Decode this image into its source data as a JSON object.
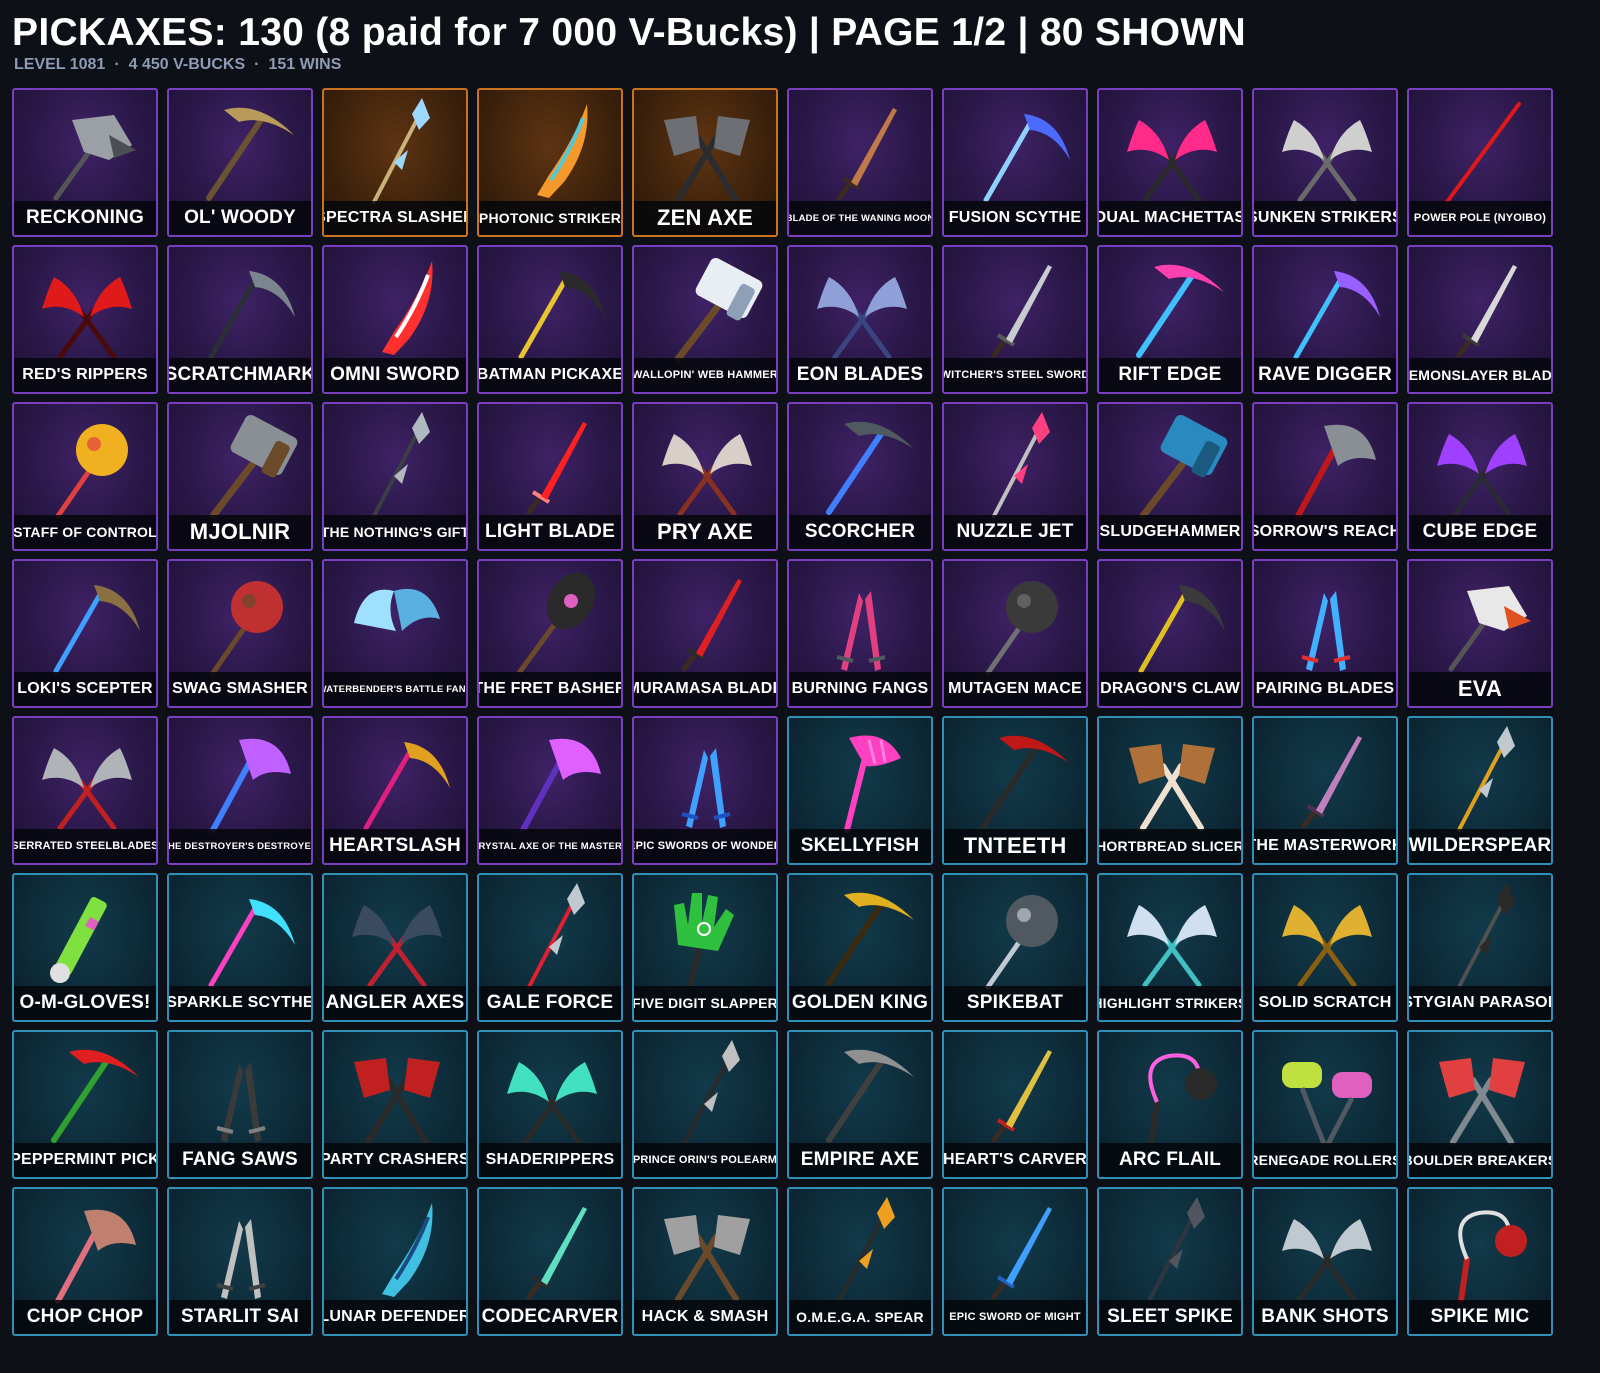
{
  "header": {
    "title": "PICKAXES: 130 (8 paid for 7 000 V-Bucks) | PAGE 1/2 | 80 SHOWN",
    "level": "LEVEL 1081",
    "vbucks": "4 450 V-BUCKS",
    "wins": "151 WINS",
    "separator": "·"
  },
  "colors": {
    "epic": "#7a3fc0",
    "legendary": "#c9731e",
    "rare": "#2f8fb6",
    "background": "#0d1016"
  },
  "items": [
    {
      "name": "RECKONING",
      "rarity": "epic",
      "icon": "claw-pick",
      "c1": "#9aa0a6",
      "c2": "#4b4f55"
    },
    {
      "name": "OL' WOODY",
      "rarity": "epic",
      "icon": "pick",
      "c1": "#b89a5a",
      "c2": "#6b5230"
    },
    {
      "name": "SPECTRA SLASHER",
      "rarity": "legendary",
      "icon": "spear",
      "c1": "#9fd8ff",
      "c2": "#c9b37a"
    },
    {
      "name": "PHOTONIC STRIKER",
      "rarity": "legendary",
      "icon": "blade",
      "c1": "#f59a2a",
      "c2": "#54c8d8"
    },
    {
      "name": "ZEN AXE",
      "rarity": "legendary",
      "icon": "dual-axe",
      "c1": "#6d6f75",
      "c2": "#2b2c30"
    },
    {
      "name": "BLADE OF THE WANING MOON",
      "rarity": "epic",
      "icon": "sword",
      "c1": "#c07a4a",
      "c2": "#3a2a20"
    },
    {
      "name": "FUSION SCYTHE",
      "rarity": "epic",
      "icon": "scythe",
      "c1": "#4b6bff",
      "c2": "#8fd0ff"
    },
    {
      "name": "DUAL MACHETTAS",
      "rarity": "epic",
      "icon": "dual-claw",
      "c1": "#ff2a8a",
      "c2": "#2a2a2a"
    },
    {
      "name": "SUNKEN STRIKERS",
      "rarity": "epic",
      "icon": "dual-claw",
      "c1": "#cfcfcf",
      "c2": "#6a6a6a"
    },
    {
      "name": "POWER POLE (NYOIBO)",
      "rarity": "epic",
      "icon": "staff",
      "c1": "#e01818",
      "c2": "#e01818"
    },
    {
      "name": "RED'S RIPPERS",
      "rarity": "epic",
      "icon": "dual-claw",
      "c1": "#e01a1a",
      "c2": "#4a0a0a"
    },
    {
      "name": "SCRATCHMARK",
      "rarity": "epic",
      "icon": "scythe",
      "c1": "#7a8590",
      "c2": "#2a2f35"
    },
    {
      "name": "OMNI SWORD",
      "rarity": "epic",
      "icon": "blade",
      "c1": "#ff3030",
      "c2": "#ffffff"
    },
    {
      "name": "BATMAN PICKAXE",
      "rarity": "epic",
      "icon": "scythe",
      "c1": "#2a2a2a",
      "c2": "#e8c530"
    },
    {
      "name": "WALLOPIN' WEB HAMMER",
      "rarity": "epic",
      "icon": "hammer",
      "c1": "#e9eef5",
      "c2": "#8ea0b8"
    },
    {
      "name": "EON BLADES",
      "rarity": "epic",
      "icon": "dual-claw",
      "c1": "#8fa0d8",
      "c2": "#3a4480"
    },
    {
      "name": "WITCHER'S STEEL SWORD",
      "rarity": "epic",
      "icon": "sword",
      "c1": "#c8ccd0",
      "c2": "#555a60"
    },
    {
      "name": "RIFT EDGE",
      "rarity": "epic",
      "icon": "pick",
      "c1": "#ff40b0",
      "c2": "#40c0ff"
    },
    {
      "name": "RAVE DIGGER",
      "rarity": "epic",
      "icon": "scythe",
      "c1": "#9a60ff",
      "c2": "#40c0ff"
    },
    {
      "name": "DEMONSLAYER BLADE",
      "rarity": "epic",
      "icon": "sword",
      "c1": "#d8d8d8",
      "c2": "#3a3a3a"
    },
    {
      "name": "STAFF OF CONTROL",
      "rarity": "epic",
      "icon": "mace",
      "c1": "#f0b020",
      "c2": "#e04040"
    },
    {
      "name": "MJOLNIR",
      "rarity": "epic",
      "icon": "hammer",
      "c1": "#8a8f96",
      "c2": "#6b4a2a"
    },
    {
      "name": "THE NOTHING'S GIFT",
      "rarity": "epic",
      "icon": "spear",
      "c1": "#b0b8c0",
      "c2": "#3a3f45"
    },
    {
      "name": "LIGHT BLADE",
      "rarity": "epic",
      "icon": "sword",
      "c1": "#ff2020",
      "c2": "#ff8080"
    },
    {
      "name": "PRY AXE",
      "rarity": "epic",
      "icon": "dual-claw",
      "c1": "#d8d0c8",
      "c2": "#8a3020"
    },
    {
      "name": "SCORCHER",
      "rarity": "epic",
      "icon": "pick",
      "c1": "#505860",
      "c2": "#4080ff"
    },
    {
      "name": "NUZZLE JET",
      "rarity": "epic",
      "icon": "spear",
      "c1": "#ff4080",
      "c2": "#c0c0c0"
    },
    {
      "name": "SLUDGEHAMMER",
      "rarity": "epic",
      "icon": "hammer",
      "c1": "#2a8ac0",
      "c2": "#1a5a80"
    },
    {
      "name": "SORROW'S REACH",
      "rarity": "epic",
      "icon": "axe",
      "c1": "#8a8f96",
      "c2": "#c01818"
    },
    {
      "name": "CUBE EDGE",
      "rarity": "epic",
      "icon": "dual-claw",
      "c1": "#a040ff",
      "c2": "#2a2a35"
    },
    {
      "name": "LOKI'S SCEPTER",
      "rarity": "epic",
      "icon": "scythe",
      "c1": "#8a7040",
      "c2": "#40a0ff"
    },
    {
      "name": "SWAG SMASHER",
      "rarity": "epic",
      "icon": "mace",
      "c1": "#c03030",
      "c2": "#6a4a2a"
    },
    {
      "name": "WATERBENDER'S BATTLE FANS",
      "rarity": "epic",
      "icon": "fans",
      "c1": "#9fe0ff",
      "c2": "#5ab0e0"
    },
    {
      "name": "THE FRET BASHER",
      "rarity": "epic",
      "icon": "guitar",
      "c1": "#2a2a2a",
      "c2": "#e060c0"
    },
    {
      "name": "MURAMASA BLADE",
      "rarity": "epic",
      "icon": "sword",
      "c1": "#e02020",
      "c2": "#2a2a2a"
    },
    {
      "name": "BURNING FANGS",
      "rarity": "epic",
      "icon": "dual-sword",
      "c1": "#e04080",
      "c2": "#505860"
    },
    {
      "name": "MUTAGEN MACE",
      "rarity": "epic",
      "icon": "mace",
      "c1": "#3a3a3a",
      "c2": "#707070"
    },
    {
      "name": "DRAGON'S CLAW",
      "rarity": "epic",
      "icon": "scythe",
      "c1": "#3a3a3a",
      "c2": "#e0c020"
    },
    {
      "name": "PAIRING BLADES",
      "rarity": "epic",
      "icon": "dual-sword",
      "c1": "#40b0ff",
      "c2": "#e03030"
    },
    {
      "name": "EVA",
      "rarity": "epic",
      "icon": "claw-pick",
      "c1": "#e8e8e8",
      "c2": "#e05020"
    },
    {
      "name": "SERRATED STEELBLADES",
      "rarity": "epic",
      "icon": "dual-claw",
      "c1": "#b0b4b8",
      "c2": "#c02020"
    },
    {
      "name": "THE DESTROYER'S DESTROYER",
      "rarity": "epic",
      "icon": "axe",
      "c1": "#c060ff",
      "c2": "#4080ff"
    },
    {
      "name": "HEARTSLASH",
      "rarity": "epic",
      "icon": "scythe",
      "c1": "#e0a020",
      "c2": "#e02080"
    },
    {
      "name": "CRYSTAL AXE OF THE MASTERS",
      "rarity": "epic",
      "icon": "axe",
      "c1": "#e060ff",
      "c2": "#6030c0"
    },
    {
      "name": "EPIC SWORDS OF WONDER",
      "rarity": "epic",
      "icon": "dual-sword",
      "c1": "#40a0ff",
      "c2": "#2050c0"
    },
    {
      "name": "SKELLYFISH",
      "rarity": "rare",
      "icon": "fishbone",
      "c1": "#ff40c0",
      "c2": "#ff80e0"
    },
    {
      "name": "TNTEETH",
      "rarity": "rare",
      "icon": "pick",
      "c1": "#c01818",
      "c2": "#2a2a2a"
    },
    {
      "name": "SHORTBREAD SLICERS",
      "rarity": "rare",
      "icon": "dual-axe",
      "c1": "#b0703a",
      "c2": "#f0e0d0"
    },
    {
      "name": "THE MASTERWORK",
      "rarity": "rare",
      "icon": "sword",
      "c1": "#c080c0",
      "c2": "#503050"
    },
    {
      "name": "WILDERSPEAR",
      "rarity": "rare",
      "icon": "spear",
      "c1": "#c0c8d0",
      "c2": "#e0a020"
    },
    {
      "name": "O-M-GLOVES!",
      "rarity": "rare",
      "icon": "stick",
      "c1": "#80e040",
      "c2": "#e060c0"
    },
    {
      "name": "SPARKLE SCYTHE",
      "rarity": "rare",
      "icon": "scythe",
      "c1": "#40e0ff",
      "c2": "#ff40c0"
    },
    {
      "name": "ANGLER AXES",
      "rarity": "rare",
      "icon": "dual-claw",
      "c1": "#3a4a60",
      "c2": "#c02030"
    },
    {
      "name": "GALE FORCE",
      "rarity": "rare",
      "icon": "spear",
      "c1": "#c0c8d0",
      "c2": "#e02030"
    },
    {
      "name": "FIVE DIGIT SLAPPER",
      "rarity": "rare",
      "icon": "hand",
      "c1": "#30c040",
      "c2": "#ffffff"
    },
    {
      "name": "GOLDEN KING",
      "rarity": "rare",
      "icon": "pick",
      "c1": "#e0b020",
      "c2": "#3a2a10"
    },
    {
      "name": "SPIKEBAT",
      "rarity": "rare",
      "icon": "mace",
      "c1": "#505860",
      "c2": "#c0c8d0"
    },
    {
      "name": "HIGHLIGHT STRIKERS",
      "rarity": "rare",
      "icon": "dual-claw",
      "c1": "#d0e0f0",
      "c2": "#40c0c0"
    },
    {
      "name": "SOLID SCRATCH",
      "rarity": "rare",
      "icon": "dual-claw",
      "c1": "#e0b030",
      "c2": "#8a6010"
    },
    {
      "name": "STYGIAN PARASOL",
      "rarity": "rare",
      "icon": "spear",
      "c1": "#2a2a2a",
      "c2": "#505050"
    },
    {
      "name": "PEPPERMINT PICK",
      "rarity": "rare",
      "icon": "pick",
      "c1": "#e02020",
      "c2": "#30a030"
    },
    {
      "name": "FANG SAWS",
      "rarity": "rare",
      "icon": "dual-sword",
      "c1": "#3a3a3a",
      "c2": "#808080"
    },
    {
      "name": "PARTY CRASHERS",
      "rarity": "rare",
      "icon": "dual-axe",
      "c1": "#c02020",
      "c2": "#2a2a2a"
    },
    {
      "name": "SHADERIPPERS",
      "rarity": "rare",
      "icon": "dual-claw",
      "c1": "#40e0c0",
      "c2": "#2a2a2a"
    },
    {
      "name": "PRINCE ORIN'S POLEARM",
      "rarity": "rare",
      "icon": "spear",
      "c1": "#c0c0c0",
      "c2": "#2a2a2a"
    },
    {
      "name": "EMPIRE AXE",
      "rarity": "rare",
      "icon": "pick",
      "c1": "#909090",
      "c2": "#404040"
    },
    {
      "name": "HEART'S CARVER",
      "rarity": "rare",
      "icon": "sword",
      "c1": "#e0c040",
      "c2": "#c02020"
    },
    {
      "name": "ARC FLAIL",
      "rarity": "rare",
      "icon": "flail",
      "c1": "#ff60e0",
      "c2": "#2a2a2a"
    },
    {
      "name": "RENEGADE ROLLERS",
      "rarity": "rare",
      "icon": "rollers",
      "c1": "#c0e040",
      "c2": "#e060c0"
    },
    {
      "name": "BOULDER BREAKERS",
      "rarity": "rare",
      "icon": "dual-axe",
      "c1": "#e04040",
      "c2": "#808890"
    },
    {
      "name": "CHOP CHOP",
      "rarity": "rare",
      "icon": "axe",
      "c1": "#c08070",
      "c2": "#e07080"
    },
    {
      "name": "STARLIT SAI",
      "rarity": "rare",
      "icon": "dual-sword",
      "c1": "#c0c0c0",
      "c2": "#404040"
    },
    {
      "name": "LUNAR DEFENDER",
      "rarity": "rare",
      "icon": "blade",
      "c1": "#40c0e0",
      "c2": "#1a4a80"
    },
    {
      "name": "CODECARVER",
      "rarity": "rare",
      "icon": "sword",
      "c1": "#60e0c0",
      "c2": "#2a2a2a"
    },
    {
      "name": "HACK & SMASH",
      "rarity": "rare",
      "icon": "dual-axe",
      "c1": "#a0a0a0",
      "c2": "#6a4a2a"
    },
    {
      "name": "O.M.E.G.A. SPEAR",
      "rarity": "rare",
      "icon": "spear",
      "c1": "#f0a020",
      "c2": "#2a2a2a"
    },
    {
      "name": "EPIC SWORD OF MIGHT",
      "rarity": "rare",
      "icon": "sword",
      "c1": "#40a0ff",
      "c2": "#2060c0"
    },
    {
      "name": "SLEET SPIKE",
      "rarity": "rare",
      "icon": "spear",
      "c1": "#505560",
      "c2": "#303540"
    },
    {
      "name": "BANK SHOTS",
      "rarity": "rare",
      "icon": "dual-claw",
      "c1": "#c0c8d0",
      "c2": "#2a2a2a"
    },
    {
      "name": "SPIKE MIC",
      "rarity": "rare",
      "icon": "flail",
      "c1": "#e0e0e0",
      "c2": "#c02020"
    }
  ]
}
